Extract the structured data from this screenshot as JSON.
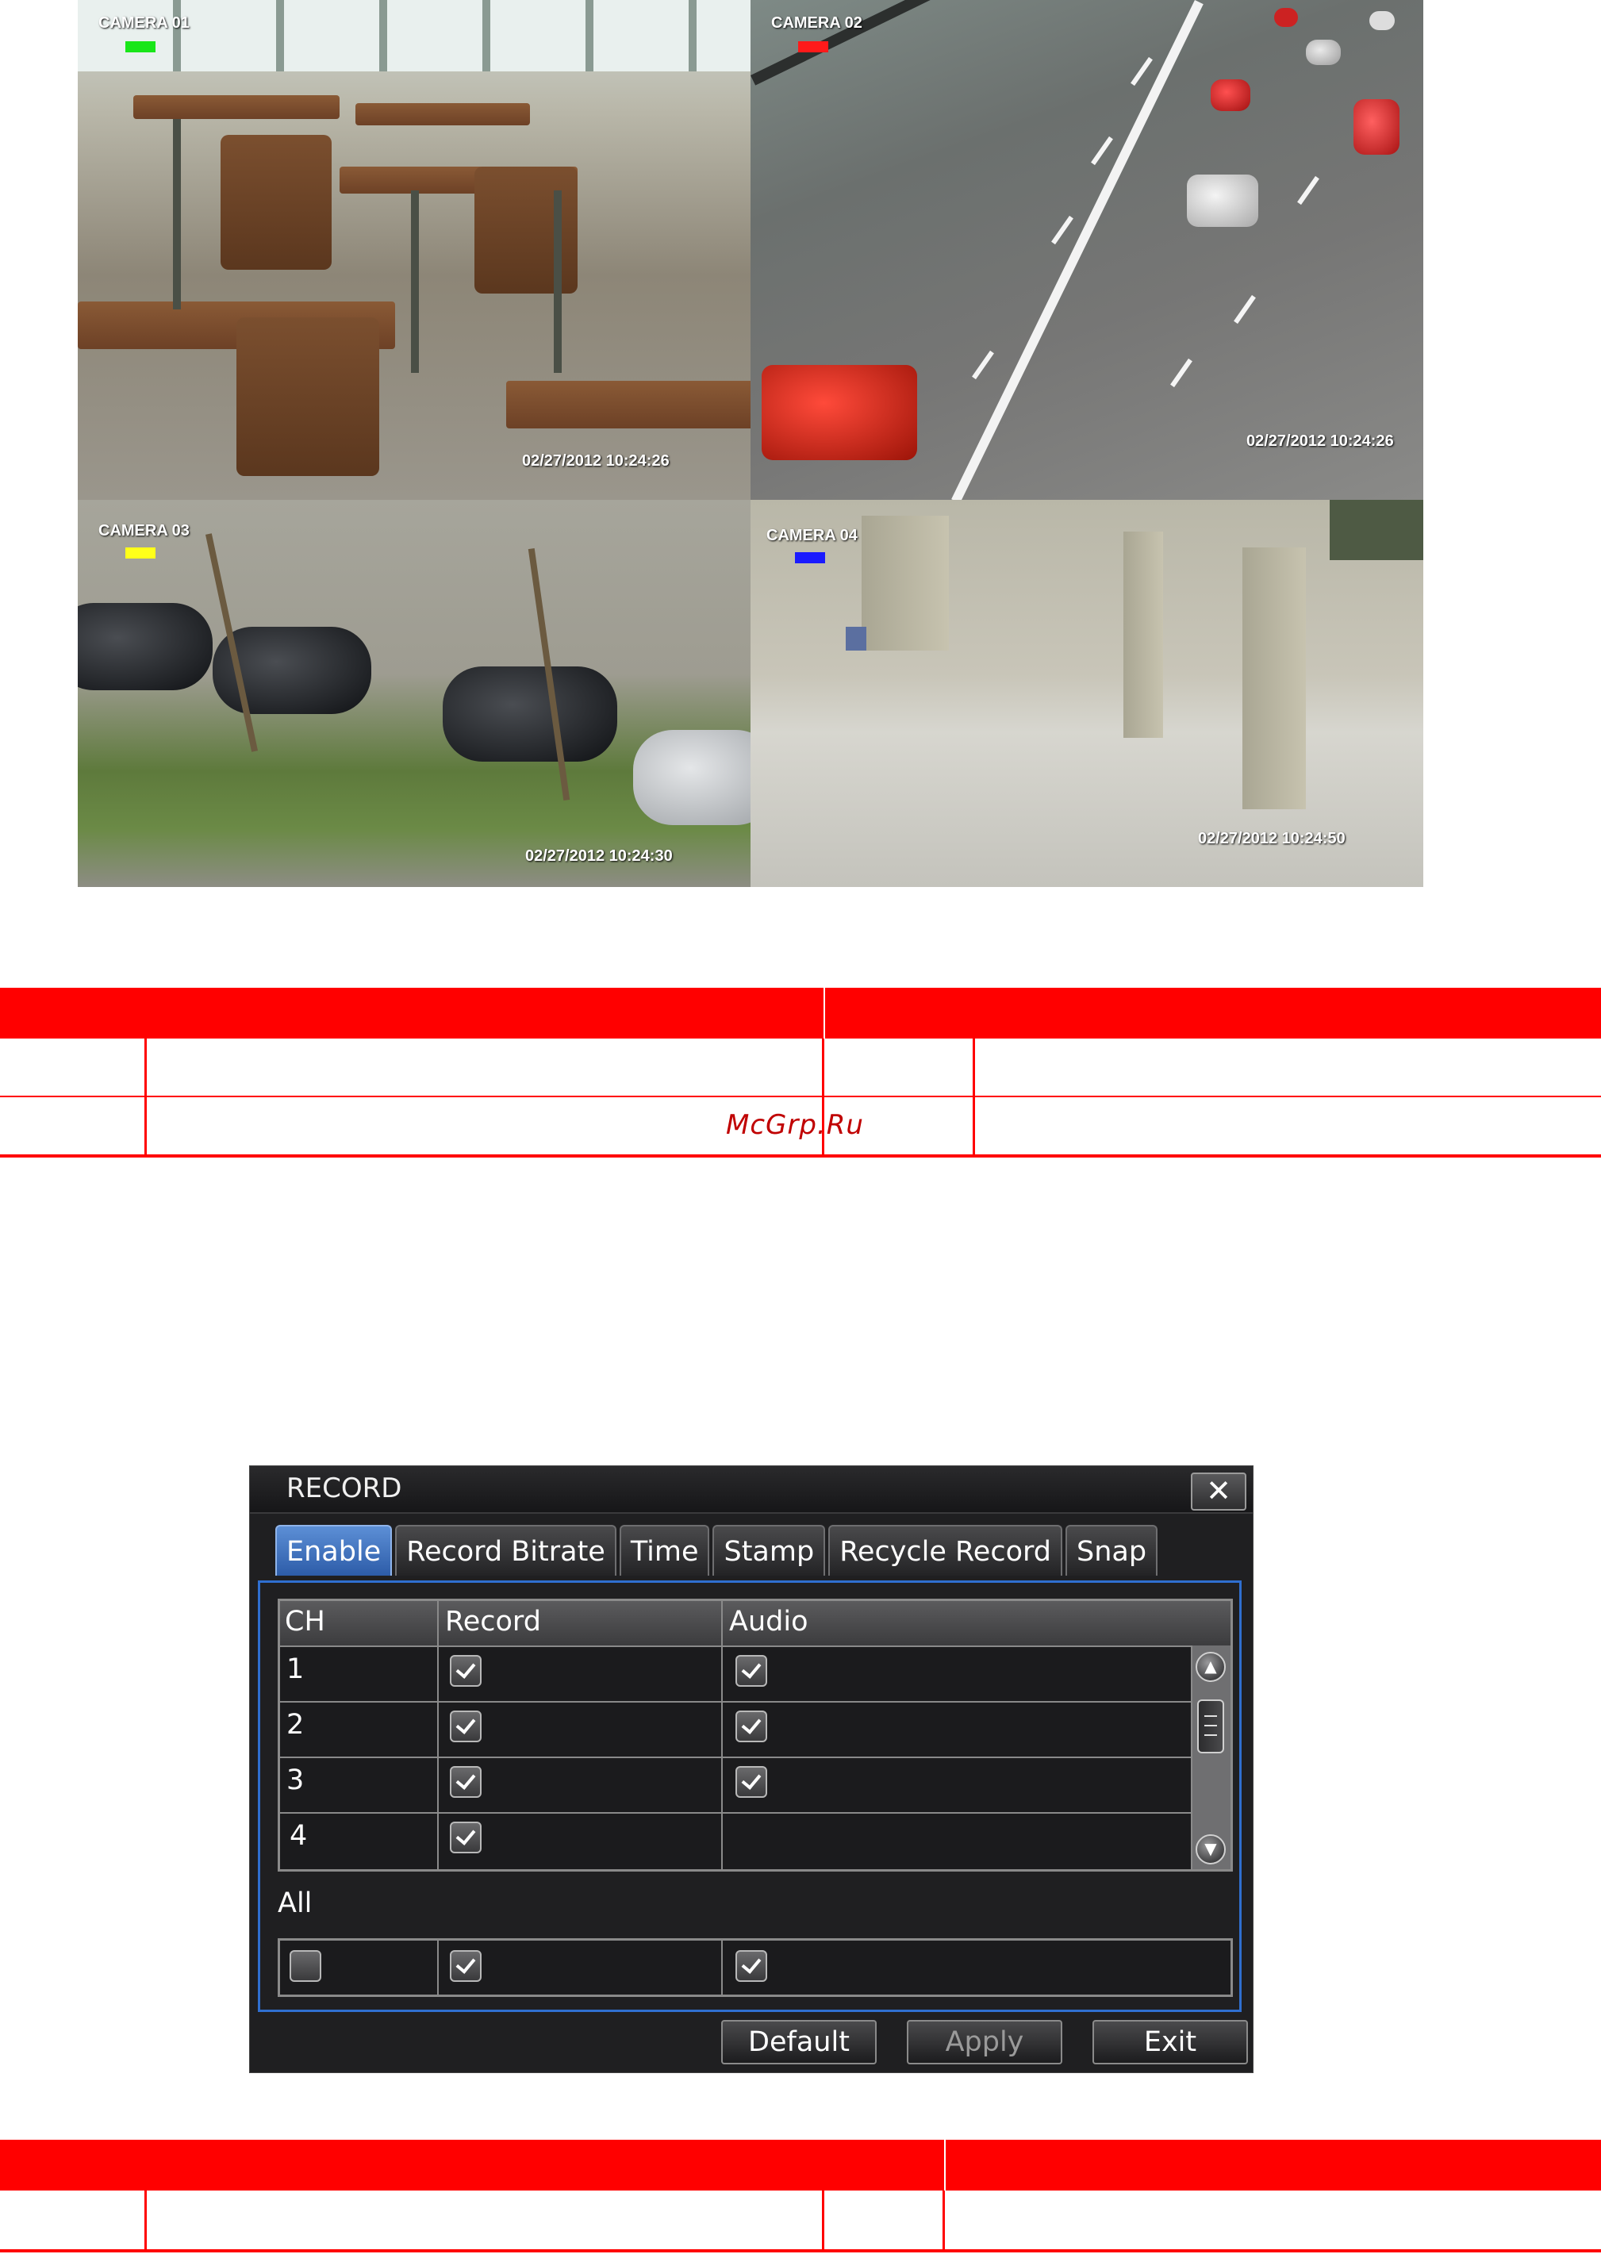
{
  "cameras": [
    {
      "label": "CAMERA 01",
      "timestamp": "02/27/2012 10:24:26",
      "tag_color": "#19e619"
    },
    {
      "label": "CAMERA 02",
      "timestamp": "02/27/2012 10:24:26",
      "tag_color": "#ff1a1a"
    },
    {
      "label": "CAMERA 03",
      "timestamp": "02/27/2012 10:24:30",
      "tag_color": "#ffff1a"
    },
    {
      "label": "CAMERA 04",
      "timestamp": "02/27/2012 10:24:50",
      "tag_color": "#1a1aff"
    }
  ],
  "watermark": "McGrp.Ru",
  "dialog": {
    "title": "RECORD",
    "close_glyph": "✕",
    "tabs": [
      "Enable",
      "Record Bitrate",
      "Time",
      "Stamp",
      "Recycle Record",
      "Snap"
    ],
    "active_tab": "Enable",
    "columns": [
      "CH",
      "Record",
      "Audio"
    ],
    "rows": [
      {
        "ch": "1",
        "record": true,
        "audio": true
      },
      {
        "ch": "2",
        "record": true,
        "audio": true
      },
      {
        "ch": "3",
        "record": true,
        "audio": true
      },
      {
        "ch": "4",
        "record": true,
        "audio": null
      }
    ],
    "all_label": "All",
    "all_row": {
      "ch": false,
      "record": true,
      "audio": true
    },
    "buttons": {
      "default": "Default",
      "apply": "Apply",
      "exit": "Exit"
    },
    "apply_enabled": false
  },
  "colors": {
    "accent_red": "#ff0000",
    "panel_border": "#2f6fd0",
    "active_tab": "#3d6fc0"
  }
}
